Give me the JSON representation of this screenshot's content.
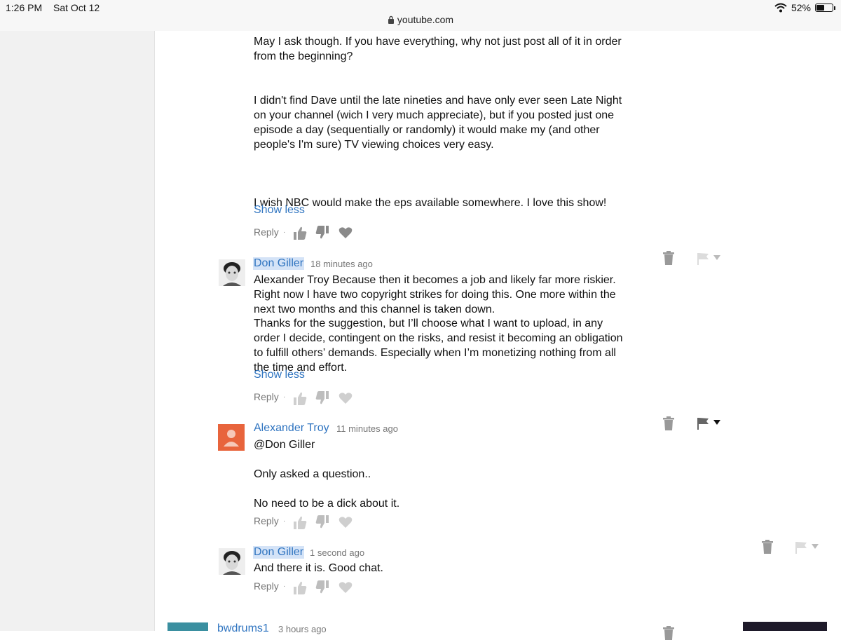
{
  "status_bar": {
    "time": "1:26 PM",
    "date": "Sat Oct 12",
    "url": "youtube.com",
    "battery": "52%",
    "battery_level": 0.52,
    "icons": [
      "lock-icon",
      "wifi-icon",
      "battery-icon"
    ]
  },
  "comment1": {
    "p1": "May I ask though. If you have everything, why not just post all of it in order from the beginning?",
    "p2": "I didn't find Dave until the late nineties and have only ever seen Late Night on your channel (wich I very much appreciate), but if you posted just one episode a day (sequentially or randomly) it would make my (and other people's I'm sure) TV viewing choices very easy.",
    "p3": "I wish NBC would make the eps available somewhere. I love this show!",
    "show_less": "Show less",
    "reply": "Reply"
  },
  "comment2": {
    "author": "Don Giller",
    "time": "18 minutes ago",
    "p1": "Alexander Troy  Because then it becomes a job and likely far more riskier. Right now I have two copyright strikes for doing this. One more within the next two months and this channel is taken down.",
    "p2": "Thanks for the suggestion, but I’ll choose what I want to upload, in any order I decide, contingent on the risks, and resist it becoming an obligation to fulfill others’ demands. Especially when I’m monetizing nothing from all the time and effort.",
    "show_less": "Show less",
    "reply": "Reply"
  },
  "comment3": {
    "author": "Alexander Troy",
    "time": "11 minutes ago",
    "line1": "@Don Giller",
    "line2": "Only asked a question..",
    "line3": "No need to be a dick about it.",
    "reply": "Reply"
  },
  "comment4": {
    "author": "Don Giller",
    "time": "1 second ago",
    "text": "And there it is. Good chat.",
    "reply": "Reply"
  },
  "comment5": {
    "author": "bwdrums1",
    "time": "3 hours ago"
  },
  "colors": {
    "link": "#2f74c0",
    "highlight": "#d4e3f7",
    "avatar_orange": "#e8643c",
    "avatar_teal": "#3a8fa0"
  }
}
